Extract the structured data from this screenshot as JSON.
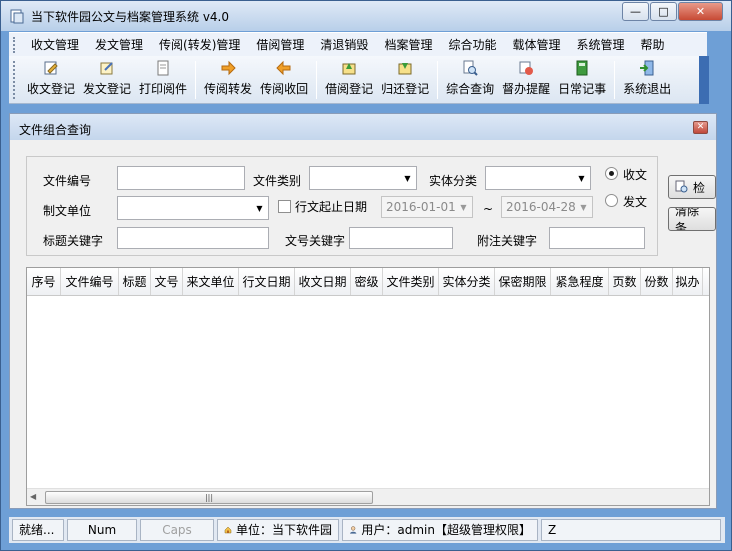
{
  "window": {
    "title": "当下软件园公文与档案管理系统 v4.0"
  },
  "menu": [
    "收文管理",
    "发文管理",
    "传阅(转发)管理",
    "借阅管理",
    "清退销毁",
    "档案管理",
    "综合功能",
    "载体管理",
    "系统管理",
    "帮助"
  ],
  "toolbar": [
    {
      "label": "收文登记",
      "icon": "edit-icon"
    },
    {
      "label": "发文登记",
      "icon": "send-doc-icon"
    },
    {
      "label": "打印阅件",
      "icon": "print-doc-icon"
    },
    {
      "label": "传阅转发",
      "icon": "forward-arrow-icon"
    },
    {
      "label": "传阅收回",
      "icon": "back-arrow-icon"
    },
    {
      "label": "借阅登记",
      "icon": "borrow-icon"
    },
    {
      "label": "归还登记",
      "icon": "return-icon"
    },
    {
      "label": "综合查询",
      "icon": "search-doc-icon"
    },
    {
      "label": "督办提醒",
      "icon": "reminder-icon"
    },
    {
      "label": "日常记事",
      "icon": "notebook-icon"
    },
    {
      "label": "系统退出",
      "icon": "exit-icon"
    }
  ],
  "child": {
    "title": "文件组合查询",
    "form": {
      "file_no_label": "文件编号",
      "file_type_label": "文件类别",
      "entity_type_label": "实体分类",
      "org_label": "制文单位",
      "date_range_label": "行文起止日期",
      "date_from": "2016-01-01",
      "date_tilde": "~",
      "date_to": "2016-04-28",
      "title_kw_label": "标题关键字",
      "doc_no_kw_label": "文号关键字",
      "note_kw_label": "附注关键字",
      "radio_receive": "收文",
      "radio_send": "发文",
      "search_button": "检",
      "clear_button": "清除条"
    },
    "columns": [
      "序号",
      "文件编号",
      "标题",
      "文号",
      "来文单位",
      "行文日期",
      "收文日期",
      "密级",
      "文件类别",
      "实体分类",
      "保密期限",
      "紧急程度",
      "页数",
      "份数",
      "拟办"
    ]
  },
  "status": {
    "ready": "就绪...",
    "num": "Num",
    "caps": "Caps",
    "unit": "单位：当下软件园",
    "user": "用户：admin【超级管理权限】",
    "extra": "Z"
  }
}
